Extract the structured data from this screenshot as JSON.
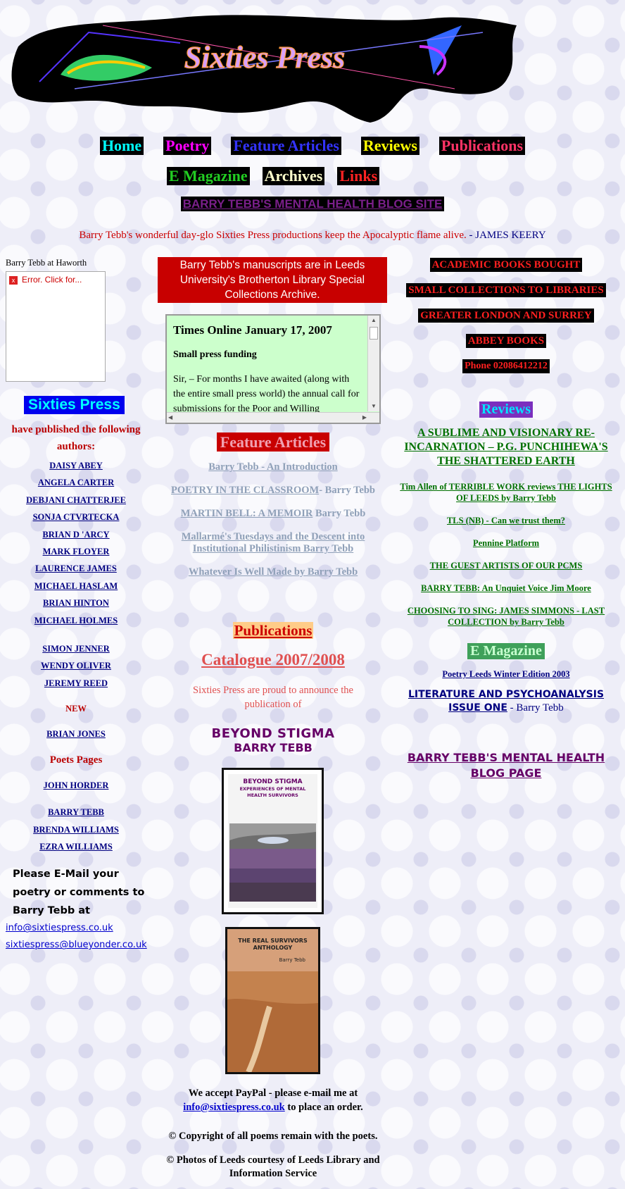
{
  "logo": {
    "text": "Sixties Press"
  },
  "nav": {
    "row1": [
      {
        "label": "Home",
        "bg": "#000000",
        "color": "#00ffff"
      },
      {
        "label": "Poetry",
        "bg": "#000000",
        "color": "#ff00ff"
      },
      {
        "label": "Feature Articles",
        "bg": "#000000",
        "color": "#3333ff"
      },
      {
        "label": "Reviews",
        "bg": "#000000",
        "color": "#ffff00"
      },
      {
        "label": "Publications",
        "bg": "#000000",
        "color": "#ff3366"
      }
    ],
    "row2": [
      {
        "label": "E Magazine",
        "bg": "#000000",
        "color": "#22cc22"
      },
      {
        "label": "Archives",
        "bg": "#000000",
        "color": "#ffffcc"
      },
      {
        "label": "Links",
        "bg": "#000000",
        "color": "#ff2222"
      }
    ],
    "blog_link": "BARRY TEBB'S MENTAL HEALTH BLOG SITE"
  },
  "quote": {
    "text": "Barry Tebb's wonderful day-glo Sixties Press productions keep the Apocalyptic flame alive.",
    "sep": " - ",
    "author": "JAMES KEERY"
  },
  "left": {
    "video_caption": "Barry Tebb at Haworth",
    "video_error": "Error. Click for...",
    "title": "Sixties Press",
    "intro": "have published the following authors:",
    "authors_a": [
      "DAISY ABEY",
      "ANGELA CARTER",
      "DEBJANI CHATTERJEE",
      "SONJA CTVRTECKA",
      "BRIAN D 'ARCY",
      "MARK FLOYER",
      "LAURENCE JAMES",
      "MICHAEL HASLAM",
      "BRIAN HINTON",
      "MICHAEL HOLMES"
    ],
    "authors_b": [
      "SIMON JENNER",
      "WENDY OLIVER",
      "JEREMY REED"
    ],
    "new_label": "NEW",
    "new_author": "BRIAN JONES",
    "poets_pages": "Poets Pages",
    "poets_a": "JOHN HORDER",
    "poets_b": [
      "BARRY TEBB",
      "BRENDA WILLIAMS",
      "EZRA WILLIAMS"
    ],
    "email_text": "Please E-Mail your poetry or comments to Barry Tebb at",
    "email1": "info@sixtiespress.co.uk",
    "email2": "sixtiespress@blueyonder.co.uk"
  },
  "middle": {
    "mss": "Barry Tebb's manuscripts are in Leeds University's Brotherton Library Special Collections Archive.",
    "times_heading": "Times Online January 17, 2007",
    "times_sub": "Small press funding",
    "times_body": "Sir, – For months I have awaited (along with the entire small press world) the annual call for submissions for the Poor and Willing",
    "feature_title": "Feature Articles",
    "features": [
      {
        "link": "Barry Tebb - An Introduction",
        "rest": ""
      },
      {
        "link": "POETRY IN THE CLASSROOM",
        "rest": "- Barry Tebb"
      },
      {
        "link": "MARTIN BELL: A MEMOIR",
        "rest": " Barry Tebb"
      },
      {
        "link": "Mallarmé's Tuesdays and the Descent into Institutional Philistinism Barry Tebb",
        "rest": ""
      },
      {
        "link": "Whatever Is Well Made by Barry Tebb",
        "rest": ""
      }
    ],
    "pub_title": "Publications",
    "catalogue": "Catalogue 2007/2008",
    "proud": "Sixties Press are proud to announce the publication of",
    "stigma_title": "BEYOND STIGMA",
    "stigma_author": "BARRY TEBB",
    "book1_title": "BEYOND STIGMA",
    "book1_sub": "EXPERIENCES OF MENTAL HEALTH SURVIVORS",
    "book2_title": "THE REAL SURVIVORS ANTHOLOGY",
    "book2_author": "Barry Tebb",
    "paypal_pre": "We accept PayPal - please e-mail me at",
    "paypal_email": "info@sixtiespress.co.uk",
    "paypal_post": " to place an order.",
    "copy1": "© Copyright of all poems remain with the poets.",
    "copy2": "© Photos of Leeds courtesy of Leeds Library and Information Service"
  },
  "right": {
    "ads": [
      "ACADEMIC BOOKS BOUGHT",
      "SMALL COLLECTIONS TO LIBRARIES",
      "GREATER LONDON AND SURREY",
      "ABBEY BOOKS",
      "Phone 02086412212"
    ],
    "reviews_title": "Reviews",
    "review_main": "A SUBLIME AND VISIONARY RE-INCARNATION – P.G. PUNCHIHEWA'S THE SHATTERED EARTH",
    "reviews": [
      "Tim Allen of TERRIBLE WORK reviews THE LIGHTS OF LEEDS by Barry Tebb",
      "TLS (NB) - Can we trust them?",
      "Pennine Platform",
      "THE GUEST ARTISTS OF OUR PCMS",
      "BARRY TEBB: An Unquiet Voice Jim Moore"
    ],
    "review_last_link": "CHOOSING TO SING: JAMES SIMMONS - LAST COLLECTION",
    "review_last_rest": " by Barry Tebb",
    "emag_title": "E Magazine",
    "emag_item": "Poetry Leeds Winter Edition 2003",
    "lit_link": "LITERATURE AND PSYCHOANALYSIS ISSUE ONE",
    "lit_rest": " - Barry Tebb",
    "mh_blog": "BARRY TEBB'S MENTAL HEALTH BLOG PAGE"
  }
}
